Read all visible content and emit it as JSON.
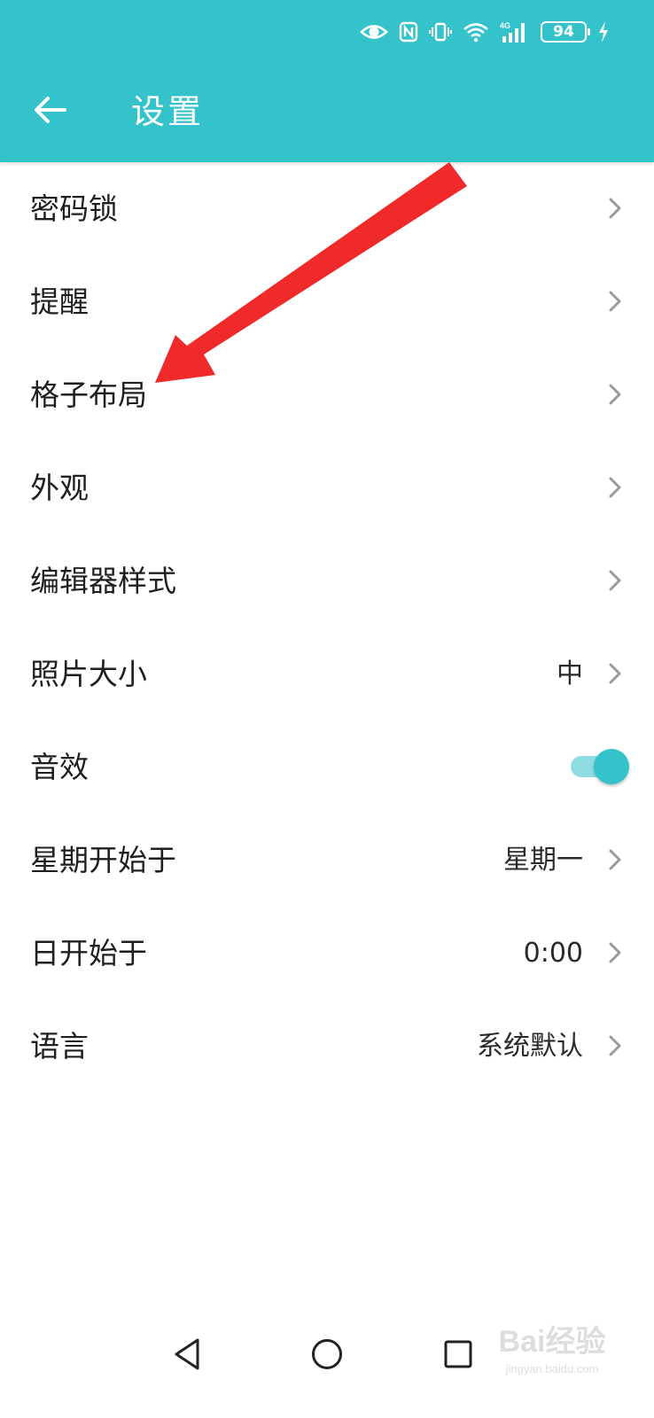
{
  "status_bar": {
    "battery_level": "94",
    "icons": [
      "eye-icon",
      "nfc-icon",
      "vibrate-icon",
      "wifi-icon",
      "signal-4g-icon",
      "battery-icon",
      "charging-icon"
    ],
    "network_label": "4G"
  },
  "header": {
    "title": "设置",
    "back_icon": "arrow-left-icon",
    "background_color": "#34c3cb"
  },
  "settings": [
    {
      "label": "密码锁",
      "value": "",
      "control": "chevron"
    },
    {
      "label": "提醒",
      "value": "",
      "control": "chevron"
    },
    {
      "label": "格子布局",
      "value": "",
      "control": "chevron"
    },
    {
      "label": "外观",
      "value": "",
      "control": "chevron"
    },
    {
      "label": "编辑器样式",
      "value": "",
      "control": "chevron"
    },
    {
      "label": "照片大小",
      "value": "中",
      "control": "chevron"
    },
    {
      "label": "音效",
      "value": "",
      "control": "toggle",
      "toggle_on": true
    },
    {
      "label": "星期开始于",
      "value": "星期一",
      "control": "chevron"
    },
    {
      "label": "日开始于",
      "value": "0:00",
      "control": "chevron"
    },
    {
      "label": "语言",
      "value": "系统默认",
      "control": "chevron"
    }
  ],
  "annotation": {
    "color": "#f02a2a"
  },
  "nav_bar": {
    "buttons": [
      "back-triangle-icon",
      "home-circle-icon",
      "recents-square-icon"
    ]
  },
  "watermark": {
    "logo": "Bai经验",
    "url": "jingyan.baidu.com"
  }
}
